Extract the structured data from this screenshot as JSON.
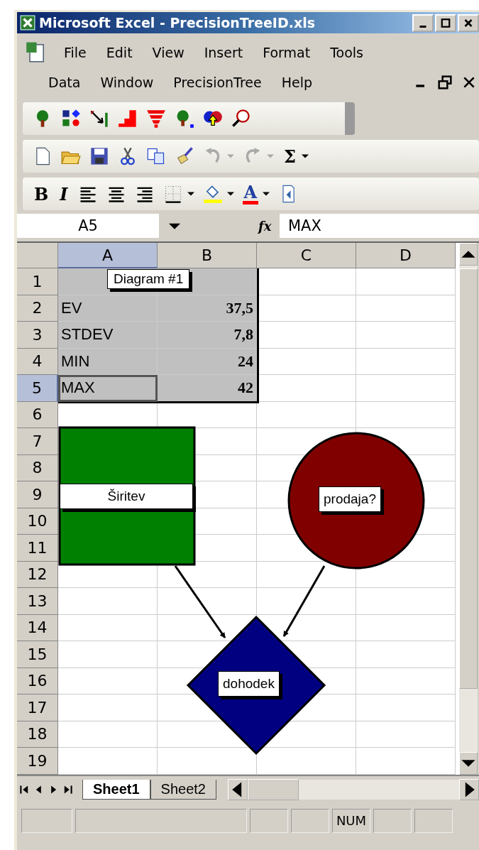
{
  "window": {
    "title": "Microsoft Excel - PrecisionTreeID.xls"
  },
  "menu": [
    {
      "items": [
        "File",
        "Edit",
        "View",
        "Insert",
        "Format",
        "Tools"
      ]
    },
    {
      "items": [
        "Data",
        "Window",
        "PrecisionTree",
        "Help"
      ]
    }
  ],
  "standard_toolbar": {
    "sum": "Σ"
  },
  "format_toolbar": {
    "bold": "B",
    "italic": "I",
    "font_color": "A"
  },
  "formula_bar": {
    "name_box": "A5",
    "fx": "fx",
    "value": "MAX"
  },
  "columns": [
    {
      "label": "A",
      "selected": true
    },
    {
      "label": "B",
      "selected": false
    },
    {
      "label": "C",
      "selected": false
    },
    {
      "label": "D",
      "selected": false
    }
  ],
  "rows": [
    {
      "label": "1",
      "selected": false,
      "a": "",
      "b": ""
    },
    {
      "label": "2",
      "selected": false,
      "a": "EV",
      "b": "37,5"
    },
    {
      "label": "3",
      "selected": false,
      "a": "STDEV",
      "b": "7,8"
    },
    {
      "label": "4",
      "selected": false,
      "a": "MIN",
      "b": "24"
    },
    {
      "label": "5",
      "selected": true,
      "a": "MAX",
      "b": "42"
    },
    {
      "label": "6",
      "selected": false,
      "a": "",
      "b": ""
    },
    {
      "label": "7",
      "selected": false,
      "a": "",
      "b": ""
    },
    {
      "label": "8",
      "selected": false,
      "a": "",
      "b": ""
    },
    {
      "label": "9",
      "selected": false,
      "a": "",
      "b": ""
    },
    {
      "label": "10",
      "selected": false,
      "a": "",
      "b": ""
    },
    {
      "label": "11",
      "selected": false,
      "a": "",
      "b": ""
    },
    {
      "label": "12",
      "selected": false,
      "a": "",
      "b": ""
    },
    {
      "label": "13",
      "selected": false,
      "a": "",
      "b": ""
    },
    {
      "label": "14",
      "selected": false,
      "a": "",
      "b": ""
    },
    {
      "label": "15",
      "selected": false,
      "a": "",
      "b": ""
    },
    {
      "label": "16",
      "selected": false,
      "a": "",
      "b": ""
    },
    {
      "label": "17",
      "selected": false,
      "a": "",
      "b": ""
    },
    {
      "label": "18",
      "selected": false,
      "a": "",
      "b": ""
    },
    {
      "label": "19",
      "selected": false,
      "a": "",
      "b": ""
    }
  ],
  "diagram": {
    "title": "Diagram #1",
    "nodes": [
      {
        "kind": "decision",
        "label": "Širitev",
        "color": "#008000"
      },
      {
        "kind": "chance",
        "label": "prodaja?",
        "color": "#800000"
      },
      {
        "kind": "payoff",
        "label": "dohodek",
        "color": "#000080"
      }
    ]
  },
  "sheet_tabs": [
    {
      "label": "Sheet1",
      "selected": true
    },
    {
      "label": "Sheet2",
      "selected": false
    }
  ],
  "status_bar": {
    "indicator": "NUM"
  }
}
